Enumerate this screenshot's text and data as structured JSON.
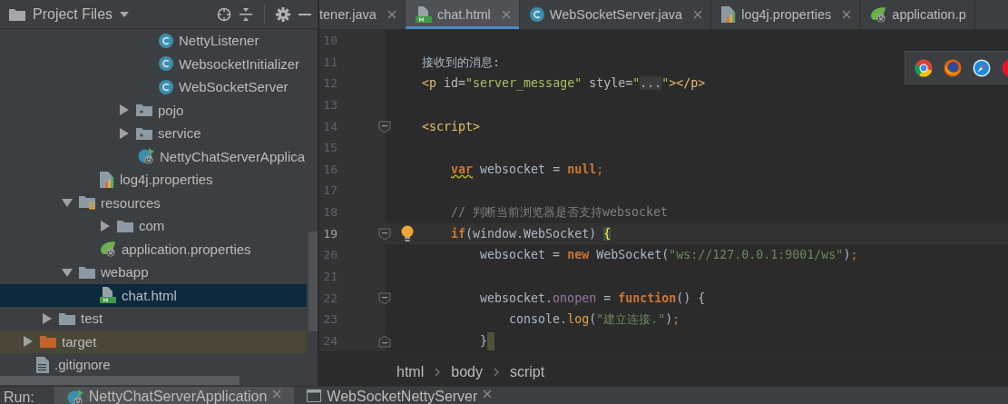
{
  "project_panel": {
    "title": "Project Files",
    "tree": [
      {
        "label": "NettyListener",
        "kind": "class",
        "selected": false
      },
      {
        "label": "WebsocketInitializer",
        "kind": "class",
        "selected": false
      },
      {
        "label": "WebSocketServer",
        "kind": "class",
        "selected": false
      },
      {
        "label": "pojo",
        "kind": "package",
        "expanded": false,
        "selected": false
      },
      {
        "label": "service",
        "kind": "package",
        "expanded": false,
        "selected": false
      },
      {
        "label": "NettyChatServerApplica",
        "kind": "spring_app",
        "selected": false
      },
      {
        "label": "log4j.properties",
        "kind": "properties",
        "selected": false
      },
      {
        "label": "resources",
        "kind": "resource_folder",
        "expanded": true,
        "selected": false,
        "children": [
          {
            "label": "com",
            "kind": "folder",
            "expanded": false,
            "selected": false
          },
          {
            "label": "application.properties",
            "kind": "spring_props",
            "selected": false
          }
        ]
      },
      {
        "label": "webapp",
        "kind": "folder",
        "expanded": true,
        "selected": false,
        "children": [
          {
            "label": "chat.html",
            "kind": "html",
            "selected": true
          }
        ]
      },
      {
        "label": "test",
        "kind": "folder",
        "expanded": false,
        "selected": false
      },
      {
        "label": "target",
        "kind": "excluded_folder",
        "expanded": false,
        "selected": false
      },
      {
        "label": ".gitignore",
        "kind": "text_file",
        "selected": false
      }
    ]
  },
  "editor": {
    "tabs": [
      {
        "label": "tener.java",
        "kind": "partial",
        "selected": false,
        "closable": true
      },
      {
        "label": "chat.html",
        "kind": "html",
        "selected": true,
        "closable": true
      },
      {
        "label": "WebSocketServer.java",
        "kind": "class",
        "selected": false,
        "closable": true
      },
      {
        "label": "log4j.properties",
        "kind": "properties",
        "selected": false,
        "closable": true
      },
      {
        "label": "application.p",
        "kind": "spring_props",
        "selected": false,
        "closable": false
      }
    ],
    "lines": [
      {
        "number": "10",
        "current": false,
        "bulb": false,
        "caret": false,
        "fold_start": false,
        "fold_end": false
      },
      {
        "number": "11",
        "current": false,
        "bulb": false,
        "caret": false,
        "fold_start": false,
        "fold_end": false,
        "tokens": [
          {
            "kind": "text",
            "text": "接收到的消息:"
          }
        ]
      },
      {
        "number": "12",
        "current": false,
        "bulb": false,
        "caret": false,
        "fold_start": false,
        "fold_end": false,
        "tokens": [
          {
            "kind": "tag",
            "text": "<p"
          },
          {
            "kind": "attr",
            "text": " id="
          },
          {
            "kind": "value",
            "text": "\"server_message\""
          },
          {
            "kind": "attr",
            "text": " style="
          },
          {
            "kind": "value",
            "text": "\""
          },
          {
            "kind": "folded",
            "text": "..."
          },
          {
            "kind": "value",
            "text": "\""
          },
          {
            "kind": "tag",
            "text": "></p>"
          }
        ]
      },
      {
        "number": "13",
        "current": false,
        "bulb": false,
        "caret": false,
        "fold_start": false,
        "fold_end": false
      },
      {
        "number": "14",
        "current": false,
        "bulb": false,
        "caret": false,
        "fold_start": true,
        "fold_end": false,
        "tokens": [
          {
            "kind": "tag",
            "text": "<script>"
          }
        ]
      },
      {
        "number": "15",
        "current": false,
        "bulb": false,
        "caret": false,
        "fold_start": false,
        "fold_end": false
      },
      {
        "number": "16",
        "current": false,
        "bulb": false,
        "caret": false,
        "fold_start": false,
        "fold_end": false,
        "tokens": [
          {
            "kind": "keyword_warn",
            "text": "    var"
          },
          {
            "kind": "plain",
            "text": " websocket = "
          },
          {
            "kind": "keyword",
            "text": "null"
          },
          {
            "kind": "punct",
            "text": ";"
          }
        ]
      },
      {
        "number": "17",
        "current": false,
        "bulb": false,
        "caret": false,
        "fold_start": false,
        "fold_end": false
      },
      {
        "number": "18",
        "current": false,
        "bulb": false,
        "caret": false,
        "fold_start": false,
        "fold_end": false,
        "tokens": [
          {
            "kind": "comment",
            "text": "    // 判断当前浏览器是否支持websocket"
          }
        ]
      },
      {
        "number": "19",
        "current": true,
        "bulb": true,
        "caret": false,
        "fold_start": true,
        "fold_end": false,
        "tokens": [
          {
            "kind": "keyword",
            "text": "    if"
          },
          {
            "kind": "plain",
            "text": "(window.WebSocket) "
          },
          {
            "kind": "brace_match",
            "text": "{"
          }
        ]
      },
      {
        "number": "20",
        "current": false,
        "bulb": false,
        "caret": false,
        "fold_start": false,
        "fold_end": false,
        "tokens": [
          {
            "kind": "plain",
            "text": "        websocket = "
          },
          {
            "kind": "keyword",
            "text": "new"
          },
          {
            "kind": "plain",
            "text": " WebSocket("
          },
          {
            "kind": "string",
            "text": "\"ws://127.0.0.1:9001/ws\""
          },
          {
            "kind": "plain",
            "text": ")"
          },
          {
            "kind": "punct",
            "text": ";"
          }
        ]
      },
      {
        "number": "21",
        "current": false,
        "bulb": false,
        "caret": false,
        "fold_start": false,
        "fold_end": false
      },
      {
        "number": "22",
        "current": false,
        "bulb": false,
        "caret": false,
        "fold_start": true,
        "fold_end": false,
        "tokens": [
          {
            "kind": "plain",
            "text": "        websocket."
          },
          {
            "kind": "field",
            "text": "onopen"
          },
          {
            "kind": "plain",
            "text": " = "
          },
          {
            "kind": "keyword",
            "text": "function"
          },
          {
            "kind": "plain",
            "text": "() {"
          }
        ]
      },
      {
        "number": "23",
        "current": false,
        "bulb": false,
        "caret": false,
        "fold_start": false,
        "fold_end": false,
        "tokens": [
          {
            "kind": "plain",
            "text": "            console."
          },
          {
            "kind": "method",
            "text": "log"
          },
          {
            "kind": "plain",
            "text": "("
          },
          {
            "kind": "string",
            "text": "\"建立连接.\""
          },
          {
            "kind": "plain",
            "text": ")"
          },
          {
            "kind": "punct",
            "text": ";"
          }
        ]
      },
      {
        "number": "24",
        "current": false,
        "bulb": false,
        "caret": true,
        "fold_start": false,
        "fold_end": true,
        "tokens": [
          {
            "kind": "plain",
            "text": "        }"
          }
        ]
      }
    ],
    "breadcrumbs": [
      "html",
      "body",
      "script"
    ],
    "browser_popup": {
      "shown": true
    }
  },
  "run_bar": {
    "label": "Run:",
    "tabs": [
      {
        "label": "NettyChatServerApplication",
        "kind": "spring_app",
        "selected": true
      },
      {
        "label": "WebSocketNettyServer",
        "kind": "console",
        "selected": false
      }
    ]
  }
}
